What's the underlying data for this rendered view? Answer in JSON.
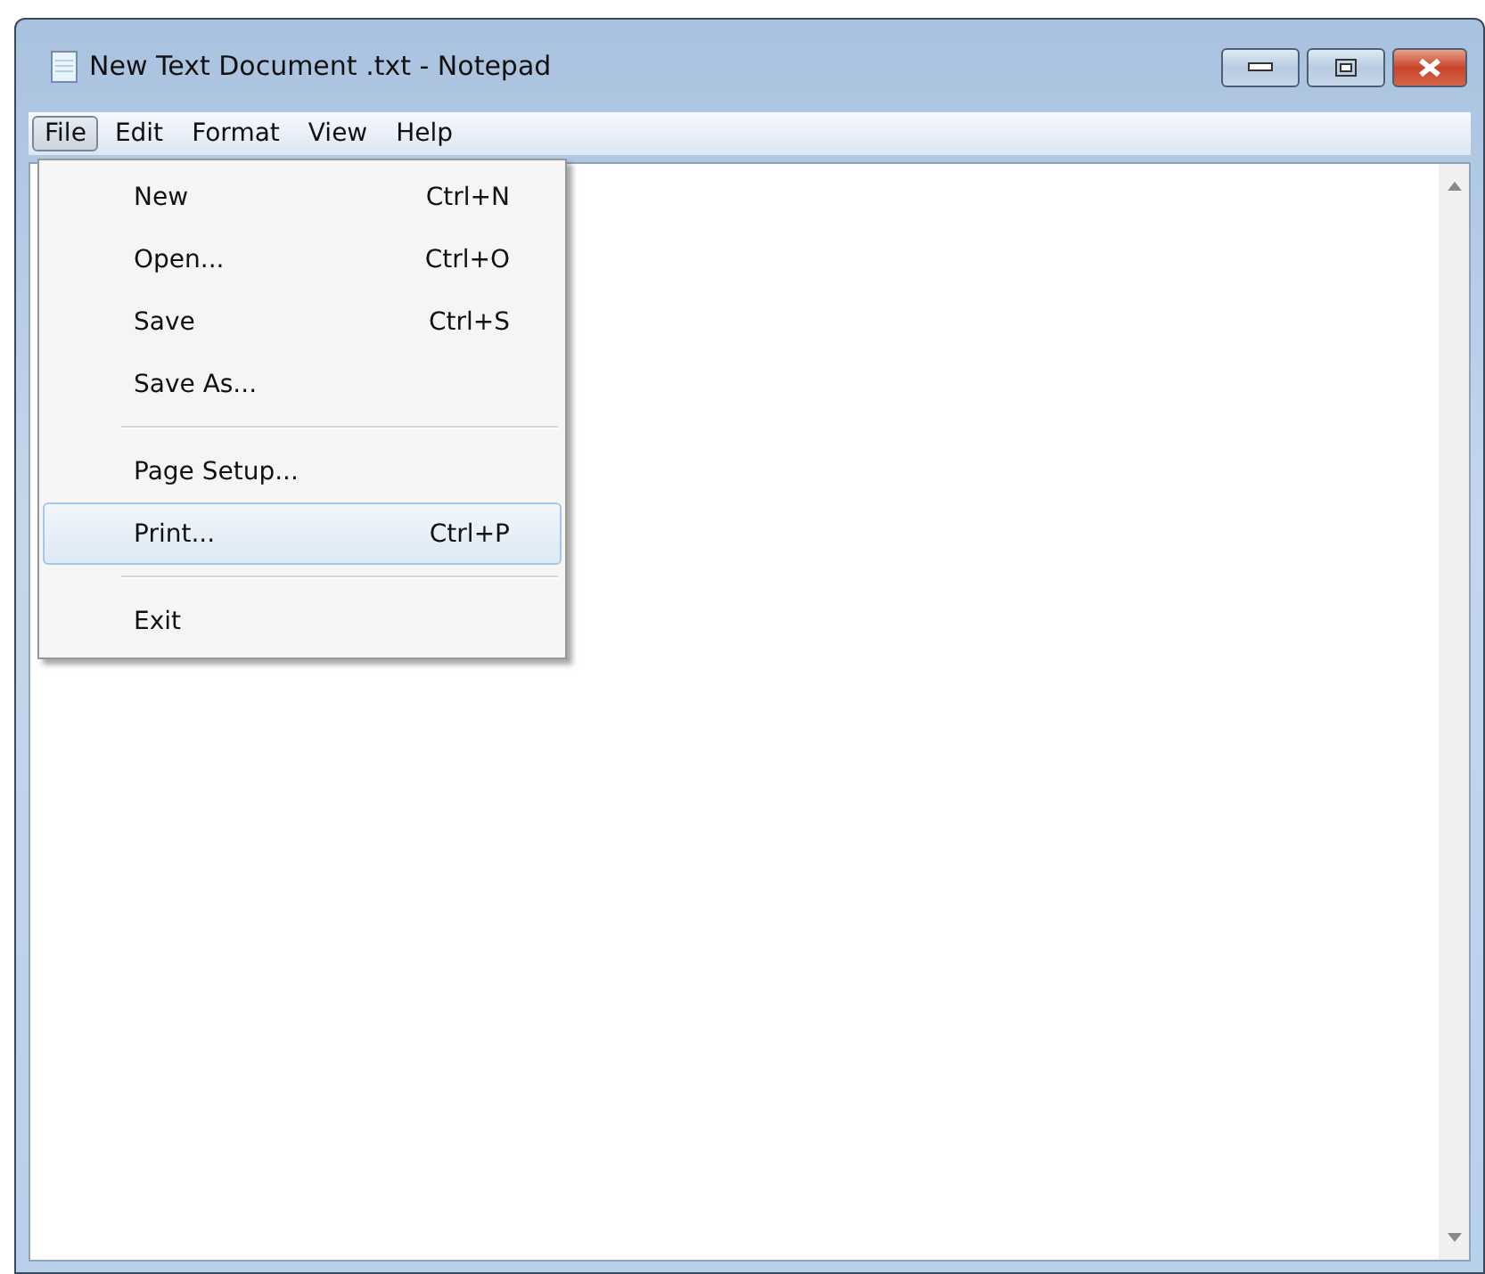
{
  "window": {
    "title": "New Text Document .txt - Notepad"
  },
  "menu_bar": [
    {
      "label": "File",
      "selected": true
    },
    {
      "label": "Edit",
      "selected": false
    },
    {
      "label": "Format",
      "selected": false
    },
    {
      "label": "View",
      "selected": false
    },
    {
      "label": "Help",
      "selected": false
    }
  ],
  "file_menu": [
    {
      "kind": "item",
      "label": "New",
      "shortcut": "Ctrl+N",
      "selected": false
    },
    {
      "kind": "item",
      "label": "Open...",
      "shortcut": "Ctrl+O",
      "selected": false
    },
    {
      "kind": "item",
      "label": "Save",
      "shortcut": "Ctrl+S",
      "selected": false
    },
    {
      "kind": "item",
      "label": "Save As...",
      "selected": false
    },
    {
      "kind": "separator"
    },
    {
      "kind": "item",
      "label": "Page Setup...",
      "selected": false
    },
    {
      "kind": "item",
      "label": "Print...",
      "shortcut": "Ctrl+P",
      "selected": true
    },
    {
      "kind": "separator"
    },
    {
      "kind": "item",
      "label": "Exit",
      "selected": false
    }
  ]
}
